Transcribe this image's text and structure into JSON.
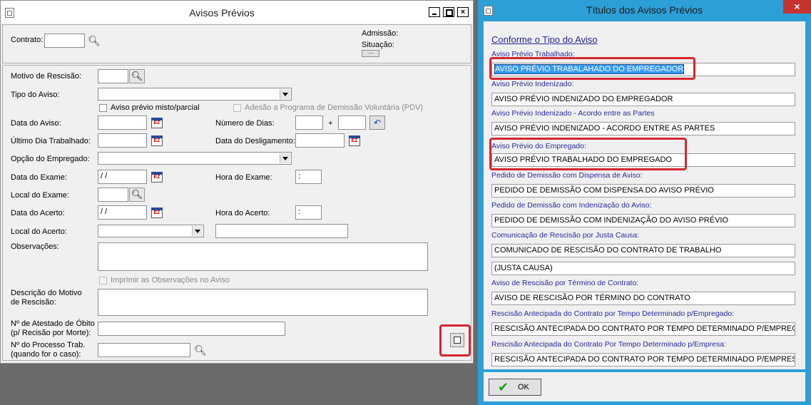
{
  "left_window": {
    "title": "Avisos Prévios",
    "close_glyph": "×",
    "header": {
      "contrato_label": "Contrato:",
      "admissao_label": "Admissão:",
      "situacao_label": "Situação:",
      "dots": "..."
    },
    "form": {
      "motivo_label": "Motivo de Rescisão:",
      "tipo_label": "Tipo do Aviso:",
      "misto_label": "Aviso prévio misto/parcial",
      "pdv_label": "Adesão a Programa de Demissão Voluntária (PDV)",
      "data_aviso_label": "Data do Aviso:",
      "numero_dias_label": "Número de Dias:",
      "plus": "+",
      "ultimo_dia_label": "Último Dia Trabalhado:",
      "data_desligamento_label": "Data do Desligamento:",
      "opcao_label": "Opção do Empregado:",
      "data_exame_label": "Data do Exame:",
      "data_exame_value": "/ /",
      "hora_exame_label": "Hora do Exame:",
      "hora_exame_value": ":",
      "local_exame_label": "Local do Exame:",
      "data_acerto_label": "Data do Acerto:",
      "data_acerto_value": "/ /",
      "hora_acerto_label": "Hora do Acerto:",
      "hora_acerto_value": ":",
      "local_acerto_label": "Local do Acerto:",
      "observacoes_label": "Observações:",
      "imprimir_label": "Imprimir as Observações no Aviso",
      "descricao_label_1": "Descrição do Motivo",
      "descricao_label_2": "de Rescisão:",
      "atestado_label_1": "Nº de Atestado de Óbito",
      "atestado_label_2": "(p/ Recisão por Morte):",
      "processo_label_1": "Nº do Processo Trab.",
      "processo_label_2": "(quando for o caso):"
    }
  },
  "right_window": {
    "title": "Títulos dos Avisos Prévios",
    "close_glyph": "×",
    "heading": "Conforme o Tipo do Aviso",
    "fields": [
      {
        "label": "Aviso Prévio Trabalhado:",
        "value": "AVISO PRÉVIO TRABALAHADO DO EMPREGADOR"
      },
      {
        "label": "Aviso Prévio Indenizado:",
        "value": "AVISO PRÉVIO INDENIZADO DO EMPREGADOR"
      },
      {
        "label": "Aviso Prévio Indenizado - Acordo entre as Partes",
        "value": "AVISO PRÉVIO INDENIZADO - ACORDO ENTRE AS PARTES"
      },
      {
        "label": "Aviso Prévio do Empregado:",
        "value": "AVISO PRÉVIO TRABALHADO DO EMPREGADO"
      },
      {
        "label": "Pedido de Demissão com Dispensa de Aviso:",
        "value": "PEDIDO DE DEMISSÃO COM DISPENSA DO AVISO PRÉVIO"
      },
      {
        "label": "Pedido de Demissão com Indenização do Aviso:",
        "value": "PEDIDO DE DEMISSÃO COM INDENIZAÇÃO DO AVISO PRÉVIO"
      },
      {
        "label": "Comunicação de Rescisão por Justa Causa:",
        "value": "COMUNICADO DE RESCISÃO DO CONTRATO DE TRABALHO",
        "value2": "(JUSTA CAUSA)"
      },
      {
        "label": "Aviso de Rescisão por Término de Contrato:",
        "value": "AVISO DE RESCISÃO POR TÉRMINO DO CONTRATO"
      },
      {
        "label": "Rescisão Antecipada do Contrato por Tempo Determinado p/Empregado:",
        "value": "RESCISÃO ANTECIPADA DO CONTRATO POR TEMPO DETERMINADO P/EMPREGADO"
      },
      {
        "label": "Rescisão Antecipada do Contrato Por Tempo Determinado p/Empresa:",
        "value": "RESCISÃO ANTECIPADA DO CONTRATO POR TEMPO DETERMINADO P/EMPRESA"
      }
    ],
    "ok_label": "OK",
    "ok_glyph": "✔"
  },
  "colors": {
    "highlight_border": "#d6262d",
    "dialog_frame": "#2d9fd7",
    "label_blue": "#2a2a9a"
  }
}
